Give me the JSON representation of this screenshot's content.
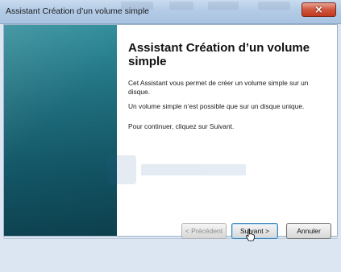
{
  "window": {
    "title": "Assistant Création d’un volume simple",
    "close_glyph": "×"
  },
  "main": {
    "heading": "Assistant Création d’un volume simple",
    "paragraphs": [
      "Cet Assistant vous permet de créer un volume simple sur un disque.",
      "Un volume simple n’est possible que sur un disque unique.",
      "Pour continuer, cliquez sur Suivant."
    ]
  },
  "footer": {
    "prev_label": "< Précédent",
    "next_label": "Suivant >",
    "cancel_label": "Annuler"
  },
  "icons": {
    "close": "close-icon",
    "cursor": "hand-cursor-icon"
  },
  "colors": {
    "side_panel": "#1f6e7e",
    "close_button": "#c23a20",
    "default_button_border": "#3c7fb1"
  }
}
